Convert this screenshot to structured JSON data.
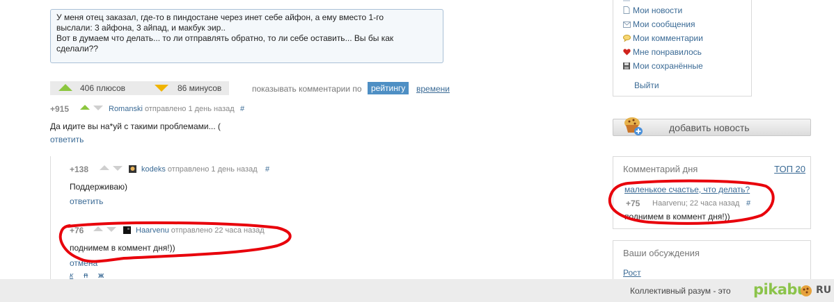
{
  "post": {
    "line1": "У меня отец заказал, где-то в пиндостане через инет себе айфон, а ему вместо 1-го",
    "line2": "выслали: 3 айфона, 3 айпад, и макбук эир..",
    "line3": "Вот в думаем что делать... то ли отправлять обратно, то ли себе оставить... Вы бы как",
    "line4": "сделали??"
  },
  "rating": {
    "plus_label": "406 плюсов",
    "minus_label": "86 минусов"
  },
  "sort": {
    "label": "показывать комментарии по",
    "active": "рейтингу",
    "other": "времени"
  },
  "comments": [
    {
      "score": "+915",
      "user": "Romanski",
      "meta": "отправлено 1 день назад",
      "hash": "#",
      "text": "Да идите вы на*уй с такими проблемами... (",
      "reply": "ответить"
    },
    {
      "score": "+138",
      "user": "kodeks",
      "meta": "отправлено 1 день назад",
      "hash": "#",
      "text": "Поддерживаю)",
      "reply": "ответить"
    },
    {
      "score": "+76",
      "user": "Haarvenu",
      "meta": "отправлено 22 часа назад",
      "text": "поднимем в коммент дня!))",
      "reply": "отмена"
    }
  ],
  "editor": {
    "italic": "к",
    "strike": "п",
    "bold": "ж"
  },
  "user_menu": {
    "items": [
      {
        "label": "Мои новости",
        "icon": "document-icon"
      },
      {
        "label": "Мои сообщения",
        "icon": "envelope-icon"
      },
      {
        "label": "Мои комментарии",
        "icon": "speech-bubble-icon"
      },
      {
        "label": "Мне понравилось",
        "icon": "heart-icon"
      },
      {
        "label": "Мои сохранённые",
        "icon": "floppy-disk-icon"
      }
    ],
    "logout": "Выйти"
  },
  "add_news": {
    "label": "добавить новость",
    "icon": "muffin-plus-icon"
  },
  "comment_of_day": {
    "title": "Комментарий дня",
    "top_link": "ТОП 20",
    "post_link": "маленькое счастье, что делать?",
    "score": "+75",
    "user_meta": "Haarvenu; 22 часа назад",
    "hash": "#",
    "text": "поднимем в коммент дня!))"
  },
  "discussions": {
    "title": "Ваши обсуждения",
    "link": "Рост"
  },
  "footer": {
    "text": "Коллективный разум - это",
    "logo": "pikabu",
    "logo_tld": "RU"
  },
  "colors": {
    "link": "#3a6a95",
    "accent_green": "#8cc63f",
    "accent_yellow": "#f0b400",
    "highlight_red": "#e8000b",
    "sort_active_bg": "#4e8fc4"
  }
}
